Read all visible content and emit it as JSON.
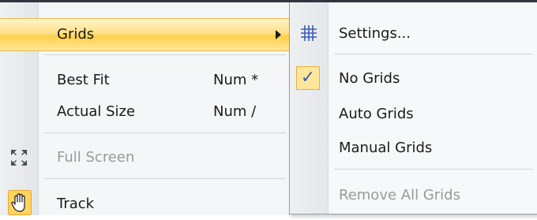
{
  "menu": {
    "items": [
      {
        "label": "Grids",
        "shortcut": "",
        "icon": "",
        "enabled": true
      },
      {
        "label": "Best Fit",
        "shortcut": "Num *",
        "icon": "",
        "enabled": true
      },
      {
        "label": "Actual Size",
        "shortcut": "Num /",
        "icon": "",
        "enabled": true
      },
      {
        "label": "Full Screen",
        "shortcut": "",
        "icon": "fullscreen-icon",
        "enabled": false
      },
      {
        "label": "Track",
        "shortcut": "",
        "icon": "hand-icon",
        "enabled": true
      }
    ]
  },
  "submenu": {
    "items": [
      {
        "label": "Settings...",
        "icon": "grid-icon",
        "checked": false,
        "enabled": true
      },
      {
        "label": "No Grids",
        "icon": "checkmark-icon",
        "checked": true,
        "enabled": true
      },
      {
        "label": "Auto Grids",
        "icon": "",
        "checked": false,
        "enabled": true
      },
      {
        "label": "Manual Grids",
        "icon": "",
        "checked": false,
        "enabled": true
      },
      {
        "label": "Remove All Grids",
        "icon": "",
        "checked": false,
        "enabled": false
      }
    ],
    "check_glyph": "✓"
  },
  "colors": {
    "highlight": "#ffd35c",
    "checked_bg": "#ffe69a",
    "disabled_text": "#9a9a9a",
    "check_color": "#3a5fb0"
  }
}
